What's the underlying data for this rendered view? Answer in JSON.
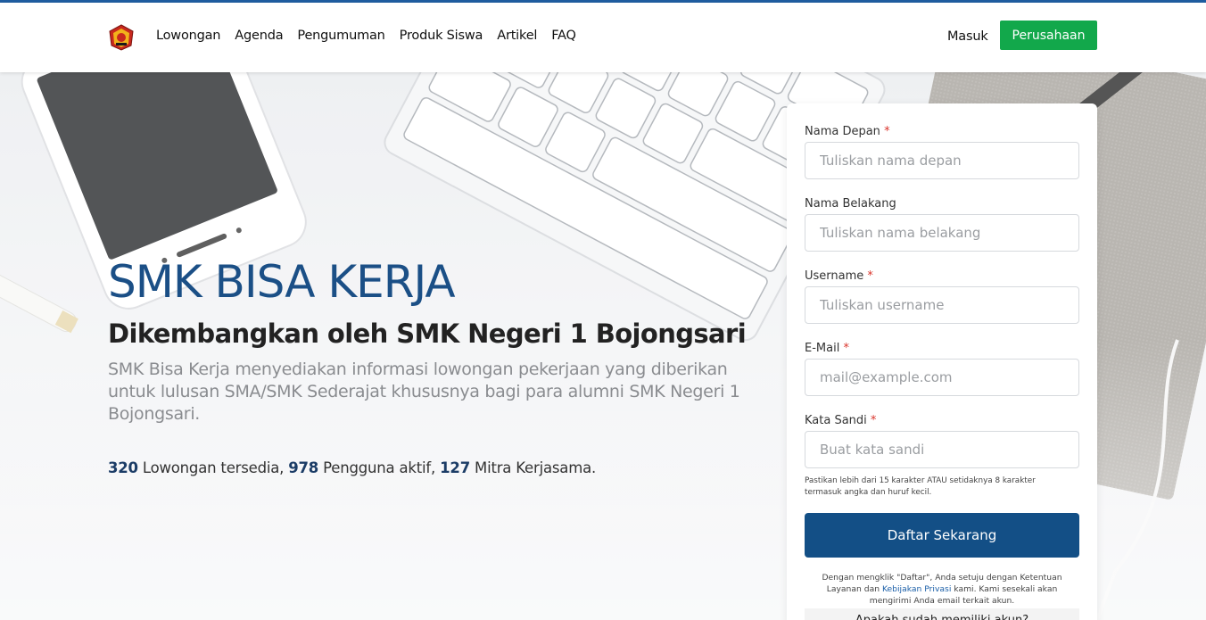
{
  "nav": {
    "links": [
      "Lowongan",
      "Agenda",
      "Pengumuman",
      "Produk Siswa",
      "Artikel",
      "FAQ"
    ],
    "login_label": "Masuk",
    "company_label": "Perusahaan"
  },
  "hero": {
    "title": "SMK BISA KERJA",
    "subtitle": "Dikembangkan oleh SMK Negeri 1 Bojongsari",
    "description": "SMK Bisa Kerja menyediakan informasi lowongan pekerjaan yang diberikan untuk lulusan SMA/SMK Sederajat khususnya bagi para alumni SMK Negeri 1 Bojongsari.",
    "stats": {
      "jobs_count": "320",
      "jobs_label": " Lowongan tersedia, ",
      "users_count": "978",
      "users_label": " Pengguna aktif, ",
      "partners_count": "127",
      "partners_label": " Mitra Kerjasama."
    }
  },
  "form": {
    "first_name": {
      "label": "Nama Depan",
      "placeholder": "Tuliskan nama depan",
      "required": "*"
    },
    "last_name": {
      "label": "Nama Belakang",
      "placeholder": "Tuliskan nama belakang"
    },
    "username": {
      "label": "Username",
      "placeholder": "Tuliskan username",
      "required": "*"
    },
    "email": {
      "label": "E-Mail",
      "placeholder": "mail@example.com",
      "required": "*"
    },
    "password": {
      "label": "Kata Sandi",
      "placeholder": "Buat kata sandi",
      "required": "*"
    },
    "password_hint": "Pastikan lebih dari 15 karakter ATAU setidaknya 8 karakter termasuk angka dan huruf kecil.",
    "submit_label": "Daftar Sekarang",
    "terms_prefix": "Dengan mengklik \"Daftar\", Anda setuju dengan Ketentuan Layanan dan ",
    "privacy_link": "Kebijakan Privasi",
    "terms_suffix": " kami. Kami sesekali akan mengirimi Anda email terkait akun.",
    "bottom_text": "Apakah sudah memiliki akun?"
  },
  "colors": {
    "brand_blue": "#134f86",
    "title_blue": "#1b4f86",
    "company_green": "#12a84b",
    "required_red": "#d9342b"
  }
}
